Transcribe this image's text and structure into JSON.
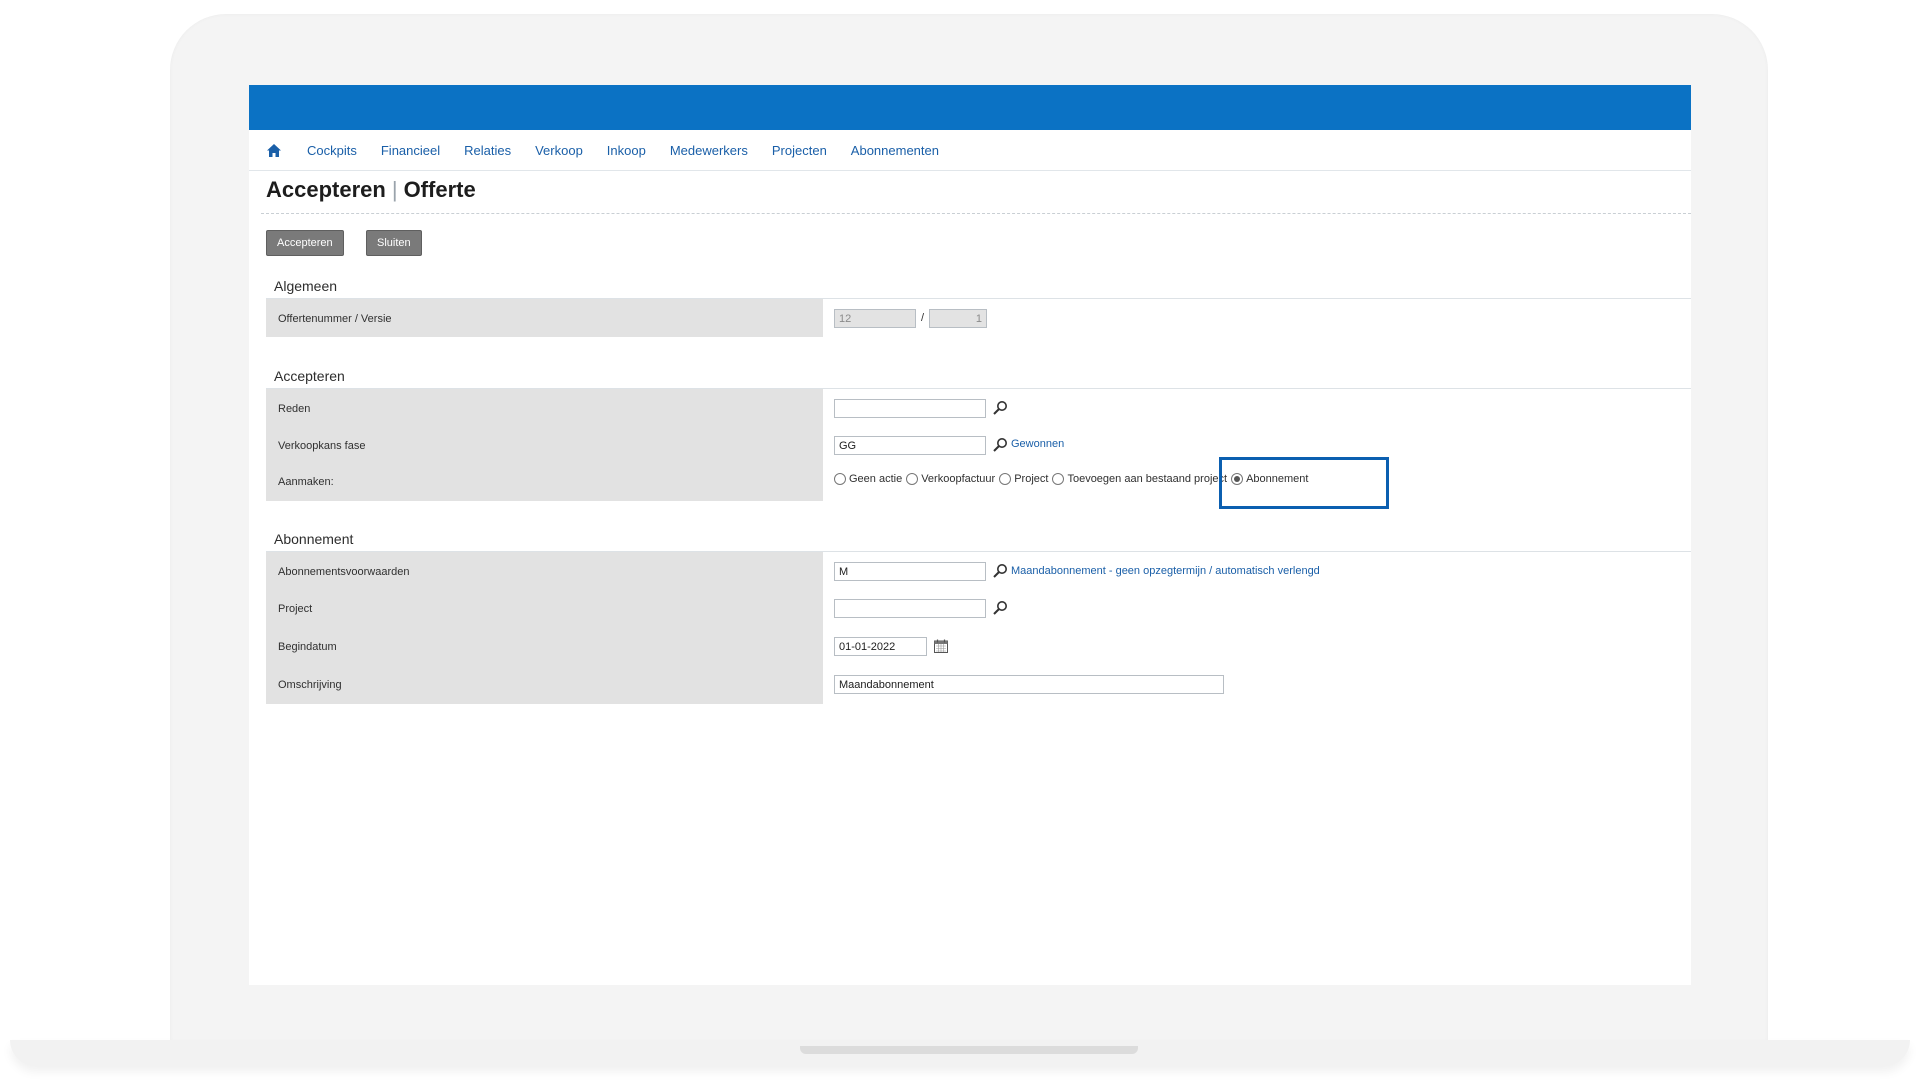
{
  "nav": {
    "items": [
      {
        "label": "Cockpits"
      },
      {
        "label": "Financieel"
      },
      {
        "label": "Relaties"
      },
      {
        "label": "Verkoop"
      },
      {
        "label": "Inkoop"
      },
      {
        "label": "Medewerkers"
      },
      {
        "label": "Projecten"
      },
      {
        "label": "Abonnementen"
      }
    ]
  },
  "page": {
    "title_main": "Accepteren",
    "title_sub": "Offerte"
  },
  "toolbar": {
    "accept_label": "Accepteren",
    "close_label": "Sluiten"
  },
  "algemeen": {
    "title": "Algemeen",
    "offer_label": "Offertenummer / Versie",
    "offer_number": "12",
    "separator": "/",
    "version": "1"
  },
  "accepteren": {
    "title": "Accepteren",
    "reden_label": "Reden",
    "reden_value": "",
    "fase_label": "Verkoopkans fase",
    "fase_value": "GG",
    "fase_link": "Gewonnen",
    "aanmaken_label": "Aanmaken:",
    "options": [
      {
        "label": "Geen actie",
        "selected": false
      },
      {
        "label": "Verkoopfactuur",
        "selected": false
      },
      {
        "label": "Project",
        "selected": false
      },
      {
        "label": "Toevoegen aan bestaand project",
        "selected": false
      },
      {
        "label": "Abonnement",
        "selected": true
      }
    ]
  },
  "abonnement": {
    "title": "Abonnement",
    "voorwaarden_label": "Abonnementsvoorwaarden",
    "voorwaarden_value": "M",
    "voorwaarden_link": "Maandabonnement - geen opzegtermijn / automatisch verlengd",
    "project_label": "Project",
    "project_value": "",
    "begindatum_label": "Begindatum",
    "begindatum_value": "01-01-2022",
    "omschrijving_label": "Omschrijving",
    "omschrijving_value": "Maandabonnement"
  },
  "colors": {
    "brand_blue": "#0b72c4",
    "link_blue": "#1a5fa8",
    "highlight_blue": "#0b5fb0",
    "label_bg": "#e2e2e2"
  }
}
